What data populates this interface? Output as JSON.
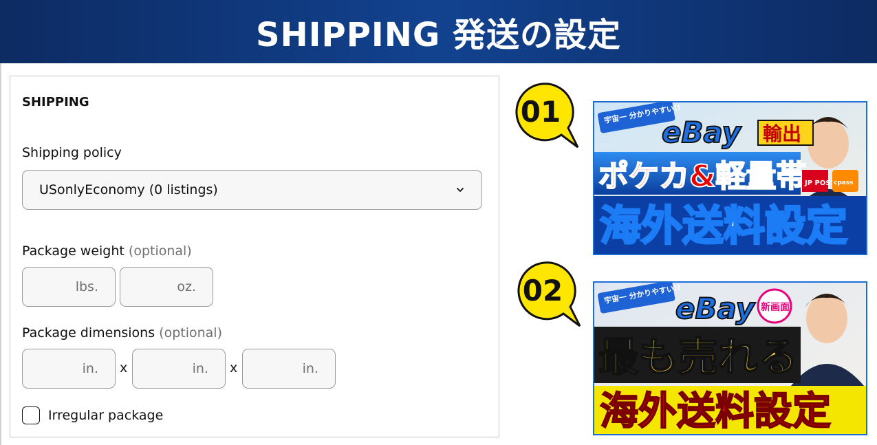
{
  "banner": {
    "title": "SHIPPING 発送の設定"
  },
  "form": {
    "section_title": "SHIPPING",
    "policy_label": "Shipping policy",
    "policy_value": "USonlyEconomy (0 listings)",
    "weight_label": "Package weight",
    "weight_optional": "(optional)",
    "weight_units": [
      "lbs.",
      "oz."
    ],
    "dims_label": "Package dimensions",
    "dims_optional": "(optional)",
    "dims_unit": "in.",
    "dims_separator": "x",
    "irregular_label": "Irregular package",
    "irregular_checked": false
  },
  "videos": [
    {
      "badge": "01",
      "tag": "宇宙一 分かりやすい!!",
      "brand": "eBay",
      "brand_suffix": "輸出",
      "headline": "ポケカ&軽量帯",
      "title": "海外送料設定",
      "logos": [
        "JP POST",
        "cpass"
      ]
    },
    {
      "badge": "02",
      "tag": "宇宙一 分かりやすい!!",
      "brand": "eBay",
      "new_badge": "新画面",
      "headline": "最も売れる",
      "title": "海外送料設定"
    }
  ],
  "colors": {
    "banner": "#12428f",
    "badge": "#ffe600",
    "thumb_border": "#1c6fd6"
  }
}
